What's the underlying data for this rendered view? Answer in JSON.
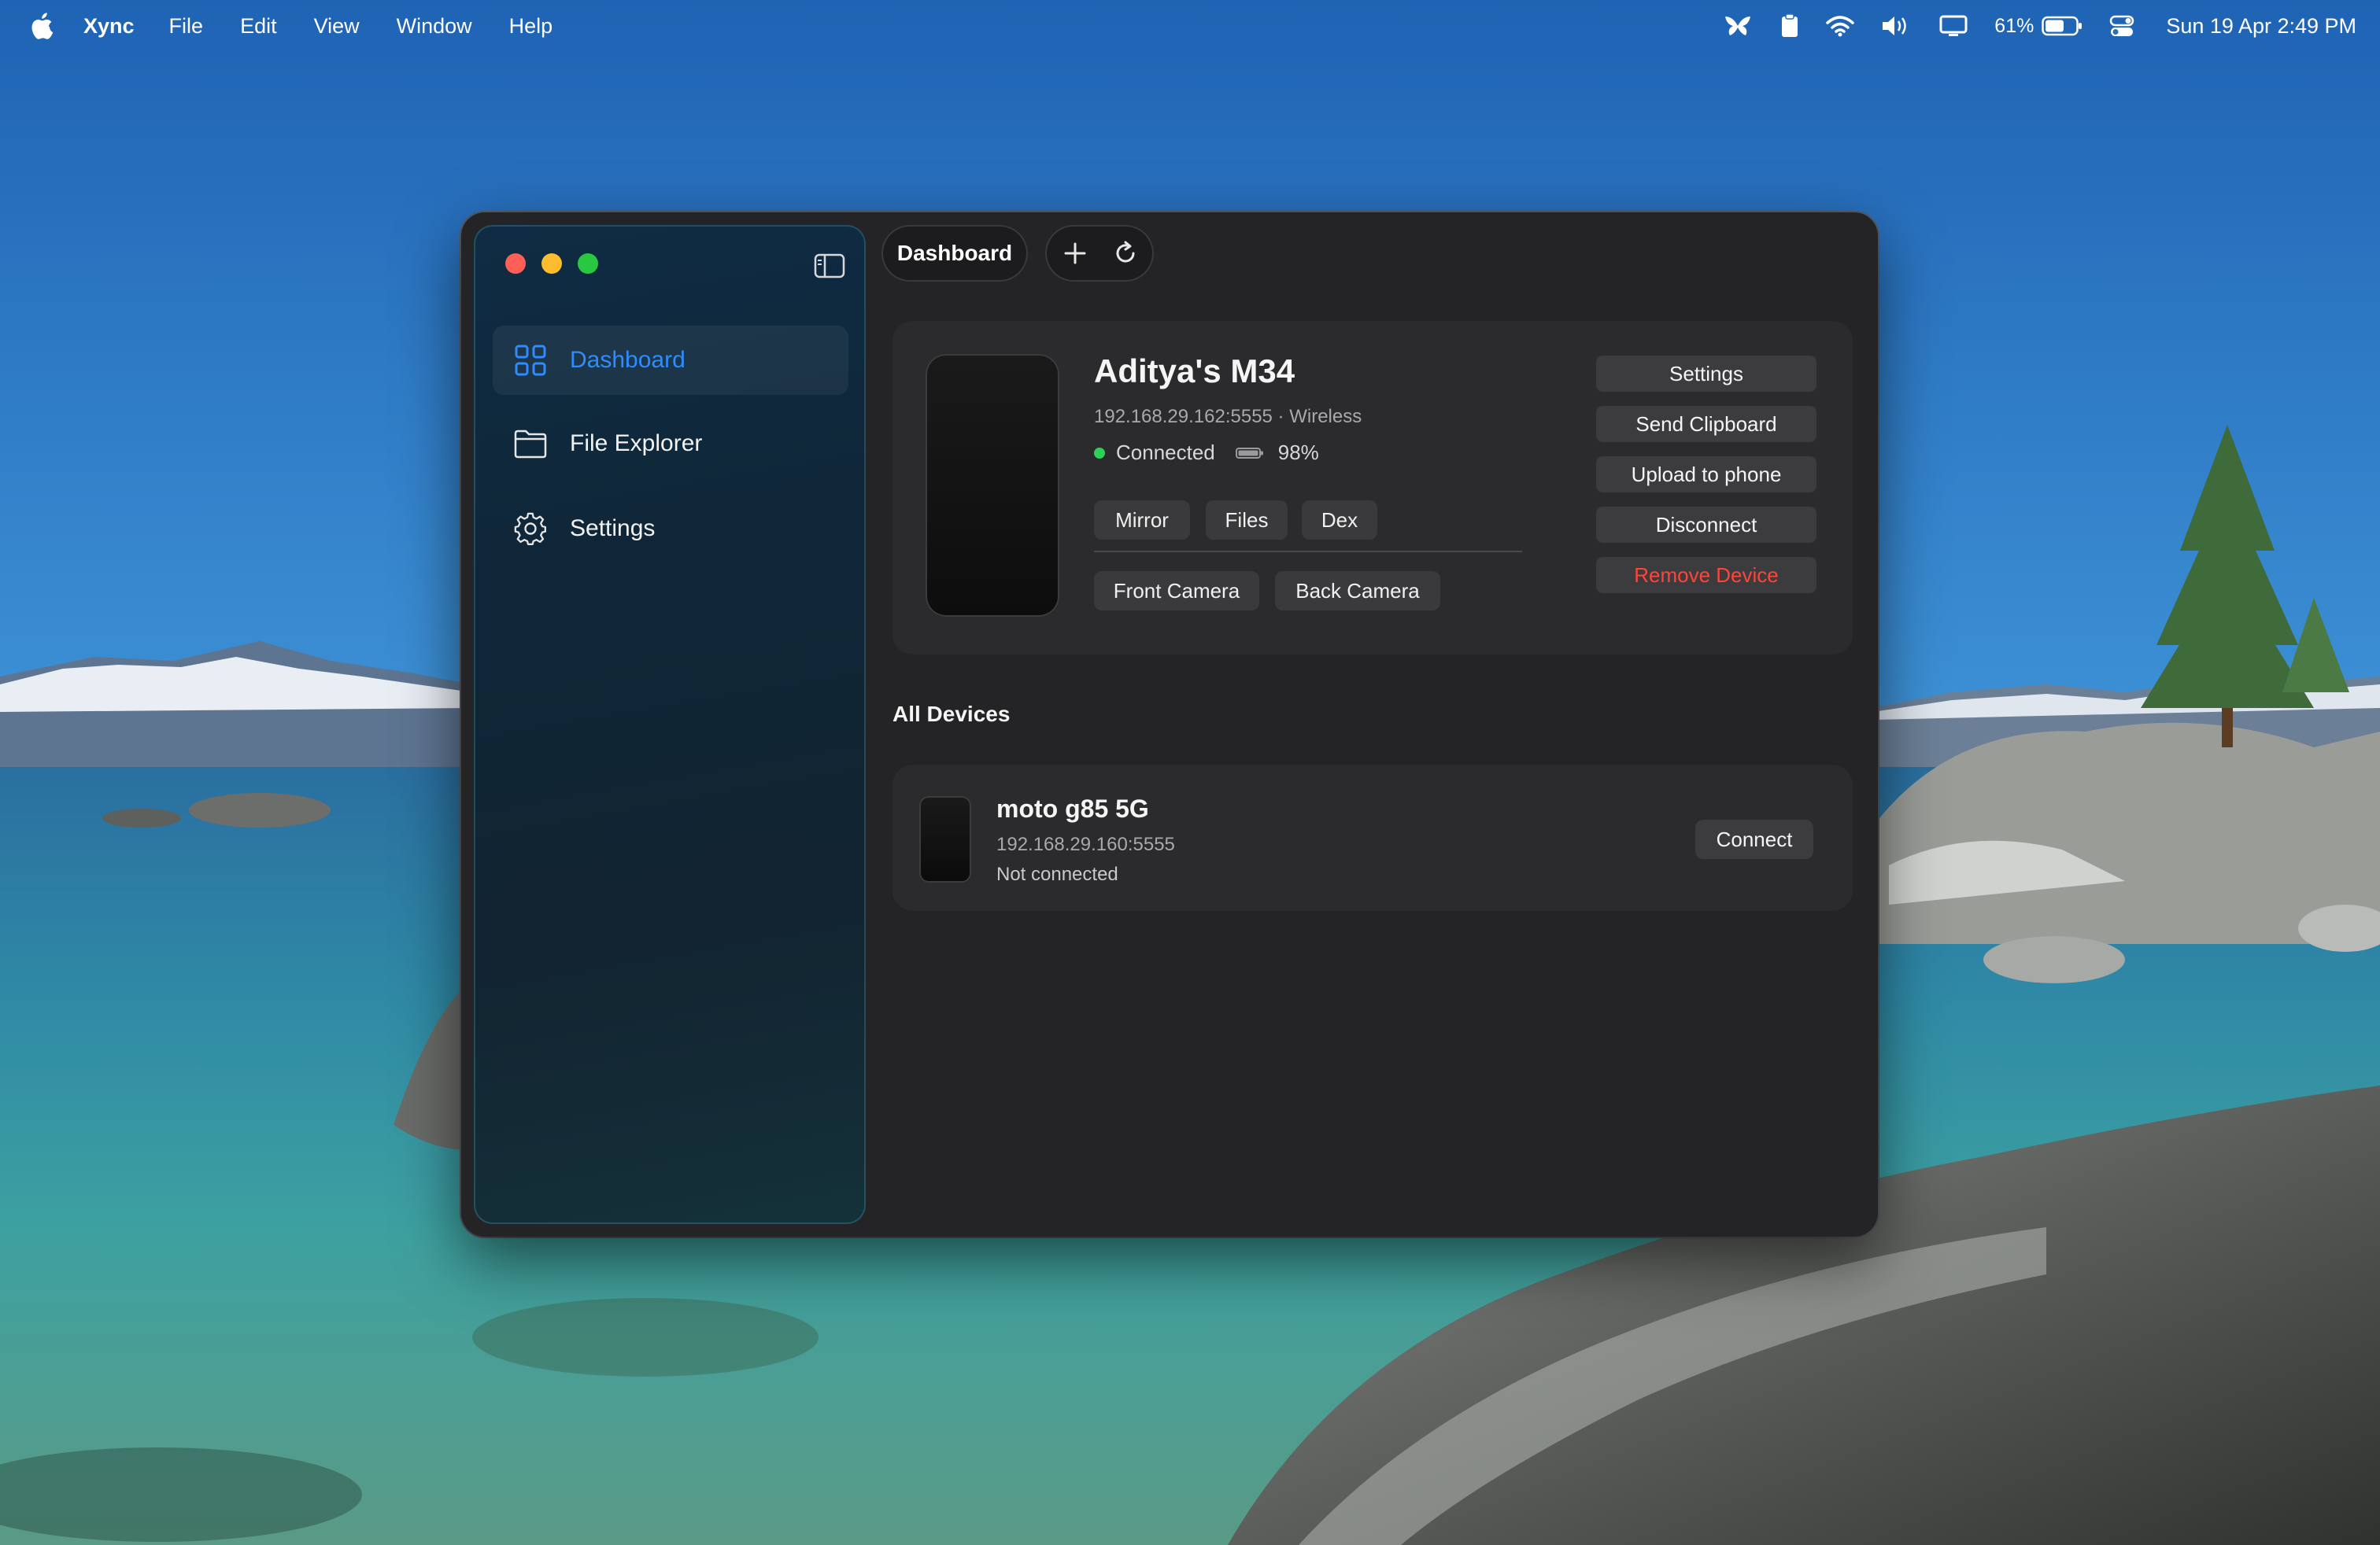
{
  "menubar": {
    "app_name": "Xync",
    "menus": [
      "File",
      "Edit",
      "View",
      "Window",
      "Help"
    ],
    "battery_percent": "61%",
    "clock": "Sun 19 Apr  2:49 PM",
    "status_icons": [
      "app-butterfly-icon",
      "clipboard-icon",
      "wifi-icon",
      "volume-icon",
      "display-icon",
      "battery-icon",
      "control-center-icon"
    ]
  },
  "sidebar": {
    "items": [
      {
        "label": "Dashboard",
        "icon": "grid-icon",
        "active": true
      },
      {
        "label": "File Explorer",
        "icon": "folder-icon",
        "active": false
      },
      {
        "label": "Settings",
        "icon": "gear-icon",
        "active": false
      }
    ]
  },
  "toolbar": {
    "tab_label": "Dashboard"
  },
  "current_device": {
    "name": "Aditya's M34",
    "address": "192.168.29.162:5555 · Wireless",
    "status": "Connected",
    "battery": "98%",
    "quick_actions": [
      "Mirror",
      "Files",
      "Dex"
    ],
    "camera_actions": [
      "Front Camera",
      "Back Camera"
    ],
    "side_actions": [
      "Settings",
      "Send Clipboard",
      "Upload to phone",
      "Disconnect",
      "Remove Device"
    ]
  },
  "all_devices": {
    "title": "All Devices",
    "devices": [
      {
        "name": "moto g85 5G",
        "address": "192.168.29.160:5555",
        "status": "Not connected",
        "action": "Connect"
      }
    ]
  },
  "colors": {
    "accent": "#2d8cff",
    "danger": "#ff453a",
    "connected": "#2ed158",
    "window_bg": "#242426",
    "card_bg": "#2b2b2d"
  }
}
